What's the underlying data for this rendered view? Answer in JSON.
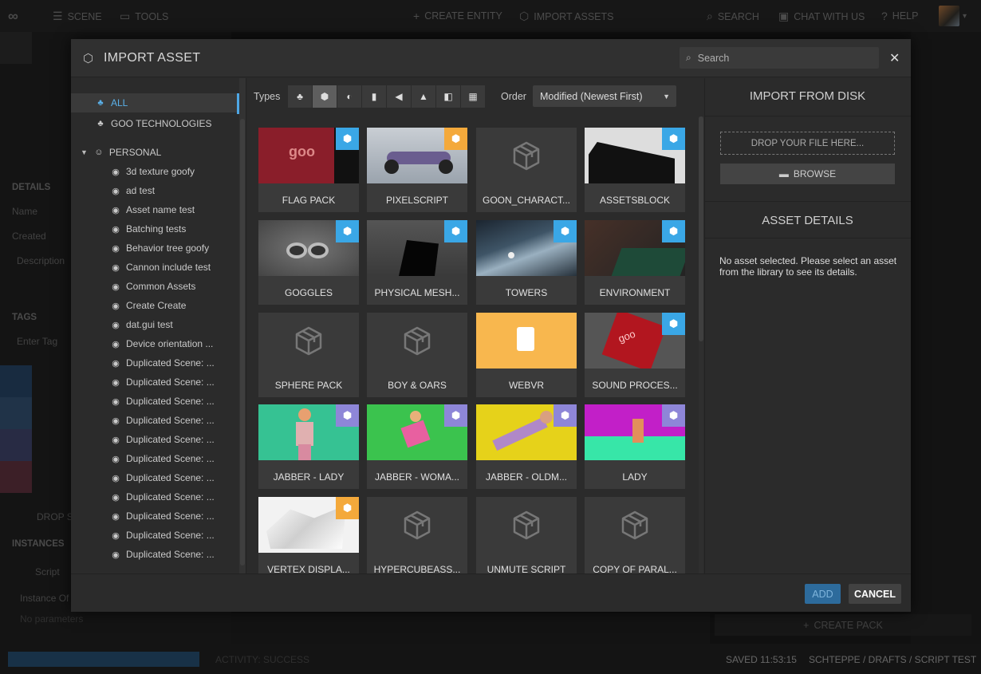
{
  "topbar": {
    "scene": "SCENE",
    "tools": "TOOLS",
    "create_entity": "CREATE ENTITY",
    "import_assets": "IMPORT ASSETS",
    "search": "SEARCH",
    "chat": "CHAT WITH US",
    "help": "HELP"
  },
  "background": {
    "details": "DETAILS",
    "name": "Name",
    "created": "Created",
    "description": "Description",
    "tags": "TAGS",
    "enter_tag": "Enter Tag",
    "drop": "DROP S",
    "instances": "INSTANCES",
    "script": "Script",
    "instance_of": "Instance Of",
    "no_params": "No parameters",
    "create_pack": "CREATE PACK"
  },
  "status": {
    "activity": "ACTIVITY: SUCCESS",
    "saved": "SAVED 11:53:15",
    "path": "SCHTEPPE / DRAFTS / SCRIPT TEST"
  },
  "modal": {
    "title": "IMPORT ASSET",
    "search_placeholder": "Search",
    "tree": [
      {
        "label": "ALL",
        "type": "all",
        "active": true
      },
      {
        "label": "GOO TECHNOLOGIES",
        "type": "org"
      },
      {
        "label": "PERSONAL",
        "type": "personal"
      },
      {
        "label": "3d texture goofy"
      },
      {
        "label": "ad test"
      },
      {
        "label": "Asset name test"
      },
      {
        "label": "Batching tests"
      },
      {
        "label": "Behavior tree goofy"
      },
      {
        "label": "Cannon include test"
      },
      {
        "label": "Common Assets"
      },
      {
        "label": "Create Create"
      },
      {
        "label": "dat.gui test"
      },
      {
        "label": "Device orientation ..."
      },
      {
        "label": "Duplicated Scene: ..."
      },
      {
        "label": "Duplicated Scene: ..."
      },
      {
        "label": "Duplicated Scene: ..."
      },
      {
        "label": "Duplicated Scene: ..."
      },
      {
        "label": "Duplicated Scene: ..."
      },
      {
        "label": "Duplicated Scene: ..."
      },
      {
        "label": "Duplicated Scene: ..."
      },
      {
        "label": "Duplicated Scene: ..."
      },
      {
        "label": "Duplicated Scene: ..."
      },
      {
        "label": "Duplicated Scene: ..."
      },
      {
        "label": "Duplicated Scene: ..."
      }
    ],
    "types_label": "Types",
    "types": [
      {
        "icon": "pack-icon",
        "on": false
      },
      {
        "icon": "entity-icon",
        "on": true
      },
      {
        "icon": "material-icon",
        "on": false
      },
      {
        "icon": "script-icon",
        "on": false
      },
      {
        "icon": "sound-icon",
        "on": false
      },
      {
        "icon": "image-icon",
        "on": false
      },
      {
        "icon": "animation-icon",
        "on": false
      },
      {
        "icon": "texture-icon",
        "on": false
      }
    ],
    "order_label": "Order",
    "order_value": "Modified (Newest First)",
    "assets": [
      {
        "label": "FLAG PACK",
        "badge": "blue",
        "thumb": "flag"
      },
      {
        "label": "PIXELSCRIPT",
        "badge": "orange",
        "thumb": "car"
      },
      {
        "label": "GOON_CHARACT...",
        "badge": "",
        "thumb": "placeholder"
      },
      {
        "label": "ASSETSBLOCK",
        "badge": "blue",
        "thumb": "block"
      },
      {
        "label": "GOGGLES",
        "badge": "blue",
        "thumb": "goggles"
      },
      {
        "label": "PHYSICAL MESH...",
        "badge": "blue",
        "thumb": "mesh"
      },
      {
        "label": "TOWERS",
        "badge": "blue",
        "thumb": "towers"
      },
      {
        "label": "ENVIRONMENT",
        "badge": "blue",
        "thumb": "environment"
      },
      {
        "label": "SPHERE PACK",
        "badge": "",
        "thumb": "placeholder"
      },
      {
        "label": "BOY & OARS",
        "badge": "",
        "thumb": "placeholder"
      },
      {
        "label": "WEBVR",
        "badge": "",
        "thumb": "webvr"
      },
      {
        "label": "SOUND PROCES...",
        "badge": "blue",
        "thumb": "cube"
      },
      {
        "label": "JABBER - LADY",
        "badge": "purple",
        "thumb": "lady-green"
      },
      {
        "label": "JABBER - WOMA...",
        "badge": "purple",
        "thumb": "woman-green"
      },
      {
        "label": "JABBER - OLDM...",
        "badge": "purple",
        "thumb": "oldman-yellow"
      },
      {
        "label": "LADY",
        "badge": "purple",
        "thumb": "lady-room"
      },
      {
        "label": "VERTEX DISPLA...",
        "badge": "orange",
        "thumb": "vertex"
      },
      {
        "label": "HYPERCUBEASS...",
        "badge": "",
        "thumb": "placeholder"
      },
      {
        "label": "UNMUTE SCRIPT",
        "badge": "",
        "thumb": "placeholder"
      },
      {
        "label": "COPY OF PARAL...",
        "badge": "",
        "thumb": "placeholder"
      }
    ],
    "import_from_disk": "IMPORT FROM DISK",
    "drop_file": "DROP YOUR FILE HERE...",
    "browse": "BROWSE",
    "asset_details": "ASSET DETAILS",
    "no_asset": "No asset selected. Please select an asset from the library to see its details.",
    "add": "ADD",
    "cancel": "CANCEL"
  }
}
